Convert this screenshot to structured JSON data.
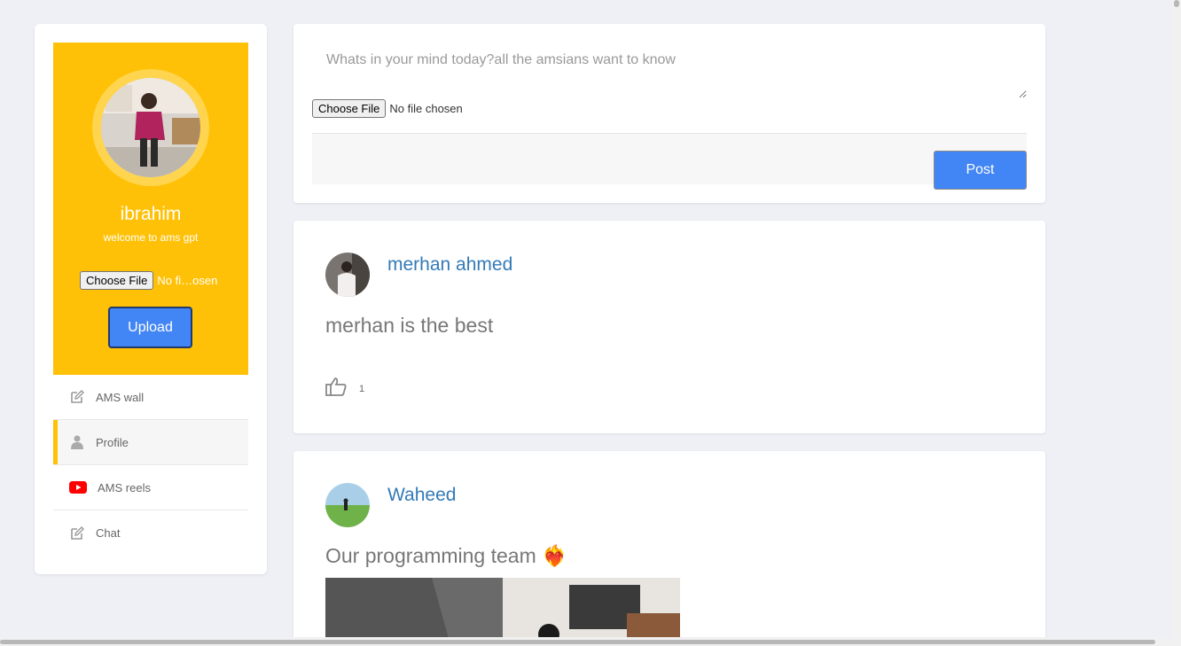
{
  "sidebar": {
    "username": "ibrahim",
    "welcome": "welcome to ams gpt",
    "file_button": "Choose File",
    "file_status": "No fi…osen",
    "upload_label": "Upload",
    "nav": [
      {
        "label": "AMS wall",
        "icon": "edit-icon"
      },
      {
        "label": "Profile",
        "icon": "user-icon",
        "active": true
      },
      {
        "label": "AMS reels",
        "icon": "youtube-icon"
      },
      {
        "label": "Chat",
        "icon": "edit-icon"
      }
    ]
  },
  "composer": {
    "placeholder": "Whats in your mind today?all the amsians want to know",
    "file_button": "Choose File",
    "file_status": "No file chosen",
    "post_label": "Post"
  },
  "posts": [
    {
      "author": "merhan ahmed",
      "text": "merhan is the best",
      "likes": "1"
    },
    {
      "author": "Waheed",
      "text": "Our programming team ❤️‍🔥"
    }
  ],
  "colors": {
    "accent": "#ffc107",
    "button": "#4285f4",
    "link": "#337ab7",
    "background": "#eff0f6"
  }
}
